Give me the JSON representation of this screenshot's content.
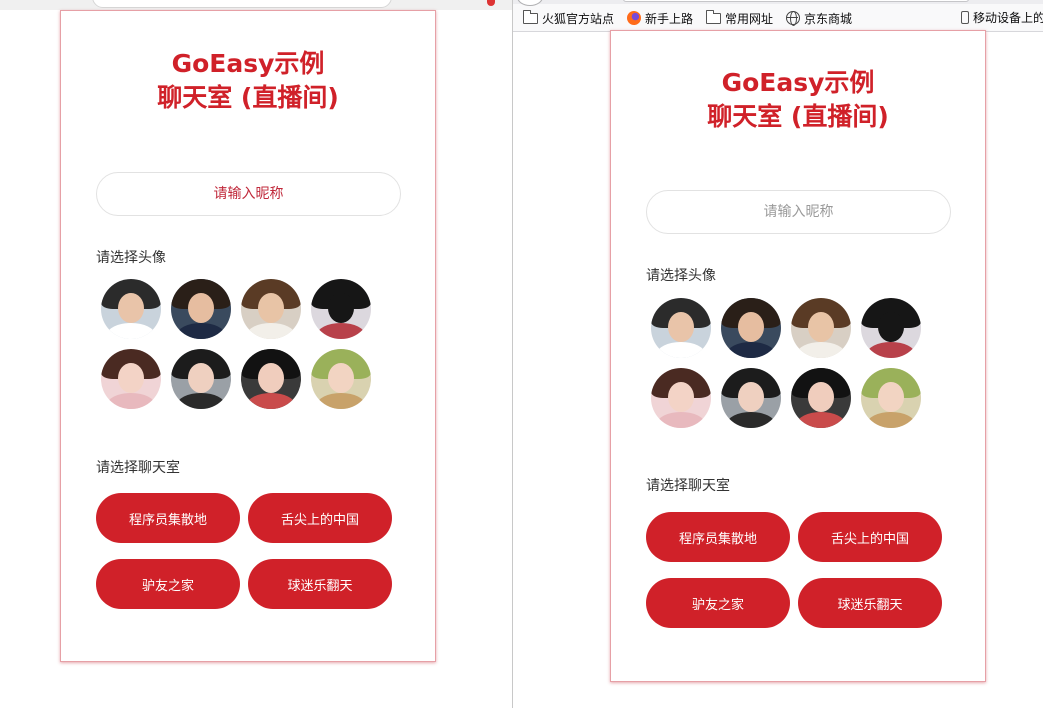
{
  "browser": {
    "bookmarks": [
      {
        "label": "火狐官方站点",
        "icon": "folder-icon"
      },
      {
        "label": "新手上路",
        "icon": "firefox-icon"
      },
      {
        "label": "常用网址",
        "icon": "folder-icon"
      },
      {
        "label": "京东商城",
        "icon": "globe-icon"
      }
    ],
    "mobile_bookmarks": "移动设备上的书签"
  },
  "app": {
    "title_line1": "GoEasy示例",
    "title_line2": "聊天室 (直播间)",
    "nickname_placeholder": "请输入昵称",
    "avatar_label": "请选择头像",
    "room_label": "请选择聊天室",
    "rooms": [
      "程序员集散地",
      "舌尖上的中国",
      "驴友之家",
      "球迷乐翻天"
    ],
    "avatars": [
      {
        "name": "avatar-man-glasses",
        "bg": "#c9d3dc",
        "hair": "#2b2b2b",
        "face": "#e9c4a9",
        "body": "#ffffff"
      },
      {
        "name": "avatar-man-navy",
        "bg": "#3a4a5e",
        "hair": "#2a1f18",
        "face": "#e6bda0",
        "body": "#1e2a44"
      },
      {
        "name": "avatar-man-round-glasses",
        "bg": "#d8cfc4",
        "hair": "#5a3b25",
        "face": "#e8c4a6",
        "body": "#f2efe9"
      },
      {
        "name": "avatar-man-back",
        "bg": "#dcd8de",
        "hair": "#161616",
        "face": "#161616",
        "body": "#b8414a"
      },
      {
        "name": "avatar-girl-pink",
        "bg": "#f0d4d6",
        "hair": "#4a2a22",
        "face": "#f3d3c6",
        "body": "#e8b9be"
      },
      {
        "name": "avatar-girl-gesture",
        "bg": "#9aa0a6",
        "hair": "#1c1c1c",
        "face": "#efd0c0",
        "body": "#2a2a2a"
      },
      {
        "name": "avatar-girl-dark",
        "bg": "#3a3a3a",
        "hair": "#121212",
        "face": "#f0cdbd",
        "body": "#c94b4b"
      },
      {
        "name": "avatar-girl-green",
        "bg": "#d9d2b0",
        "hair": "#9ab15a",
        "face": "#f2d4c2",
        "body": "#c8a26a"
      }
    ]
  }
}
